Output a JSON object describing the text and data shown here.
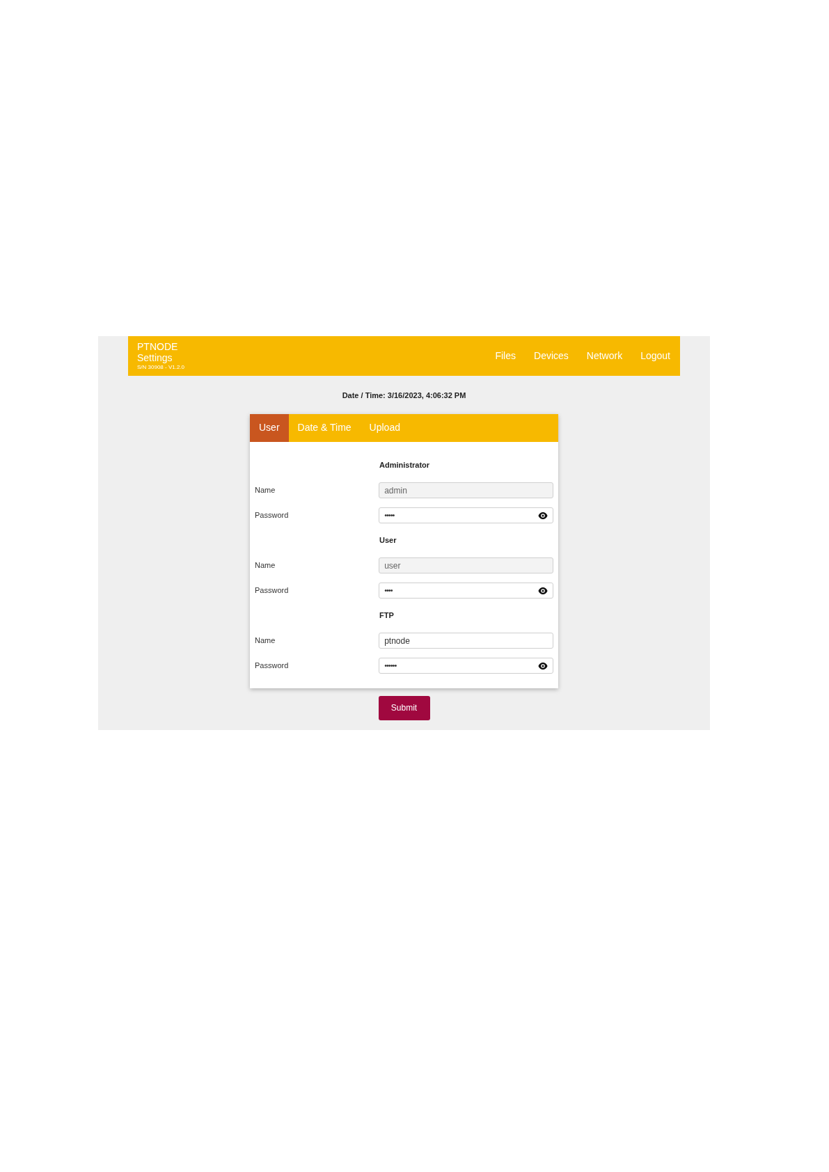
{
  "header": {
    "title": "PTNODE",
    "subtitle": "Settings",
    "serial": "S/N 30908 - V1.2.0",
    "nav": [
      "Files",
      "Devices",
      "Network",
      "Logout"
    ]
  },
  "datetime": "Date / Time: 3/16/2023, 4:06:32 PM",
  "tabs": [
    {
      "label": "User",
      "selected": true
    },
    {
      "label": "Date & Time",
      "selected": false
    },
    {
      "label": "Upload",
      "selected": false
    }
  ],
  "sections": [
    {
      "heading": "Administrator",
      "fields": [
        {
          "kind": "text",
          "label": "Name",
          "value": "admin",
          "disabled": true
        },
        {
          "kind": "password",
          "label": "Password",
          "value": "•••••",
          "disabled": false
        }
      ]
    },
    {
      "heading": "User",
      "fields": [
        {
          "kind": "text",
          "label": "Name",
          "value": "user",
          "disabled": true
        },
        {
          "kind": "password",
          "label": "Password",
          "value": "••••",
          "disabled": false
        }
      ]
    },
    {
      "heading": "FTP",
      "fields": [
        {
          "kind": "text",
          "label": "Name",
          "value": "ptnode",
          "disabled": false
        },
        {
          "kind": "password",
          "label": "Password",
          "value": "••••••",
          "disabled": false
        }
      ]
    }
  ],
  "submit": "Submit"
}
